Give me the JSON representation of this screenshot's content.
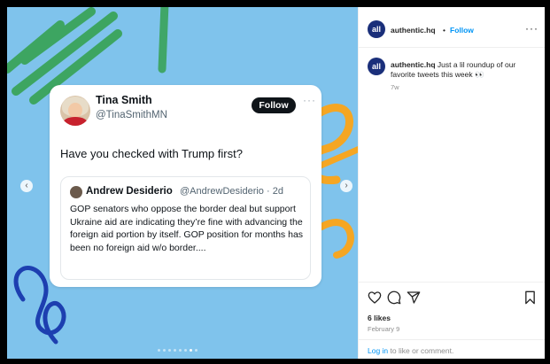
{
  "tweet": {
    "name": "Tina Smith",
    "handle": "@TinaSmithMN",
    "follow_label": "Follow",
    "more": "···",
    "text": "Have you checked with Trump first?",
    "quote": {
      "name": "Andrew Desiderio",
      "handle": "@AndrewDesiderio · 2d",
      "text": "GOP senators who oppose the border deal but support Ukraine aid are indicating they’re fine with advancing the foreign aid portion by itself. GOP position for months has been no foreign aid w/o border...."
    }
  },
  "carousel": {
    "prev_icon": "‹",
    "next_icon": "›",
    "slide_count": 8,
    "active_index": 6
  },
  "post": {
    "logo_text": "all",
    "username": "authentic.hq",
    "separator": "•",
    "follow_label": "Follow",
    "more": "···",
    "caption_user": "authentic.hq",
    "caption_text": "Just a lil roundup of our favorite tweets this week 👀",
    "caption_time": "7w",
    "likes": "6 likes",
    "date": "February 9",
    "login_link": "Log in",
    "login_rest": " to like or comment."
  },
  "icons": {
    "like": "heart-icon",
    "comment": "comment-icon",
    "share": "share-icon",
    "save": "bookmark-icon"
  },
  "colors": {
    "media_bg": "#7fc3ec",
    "accent_blue": "#0095f6",
    "logo_navy": "#1a2f7a",
    "scribble_green": "#3aa35a",
    "scribble_orange": "#f5a623",
    "scribble_navy": "#1d3fb0"
  }
}
